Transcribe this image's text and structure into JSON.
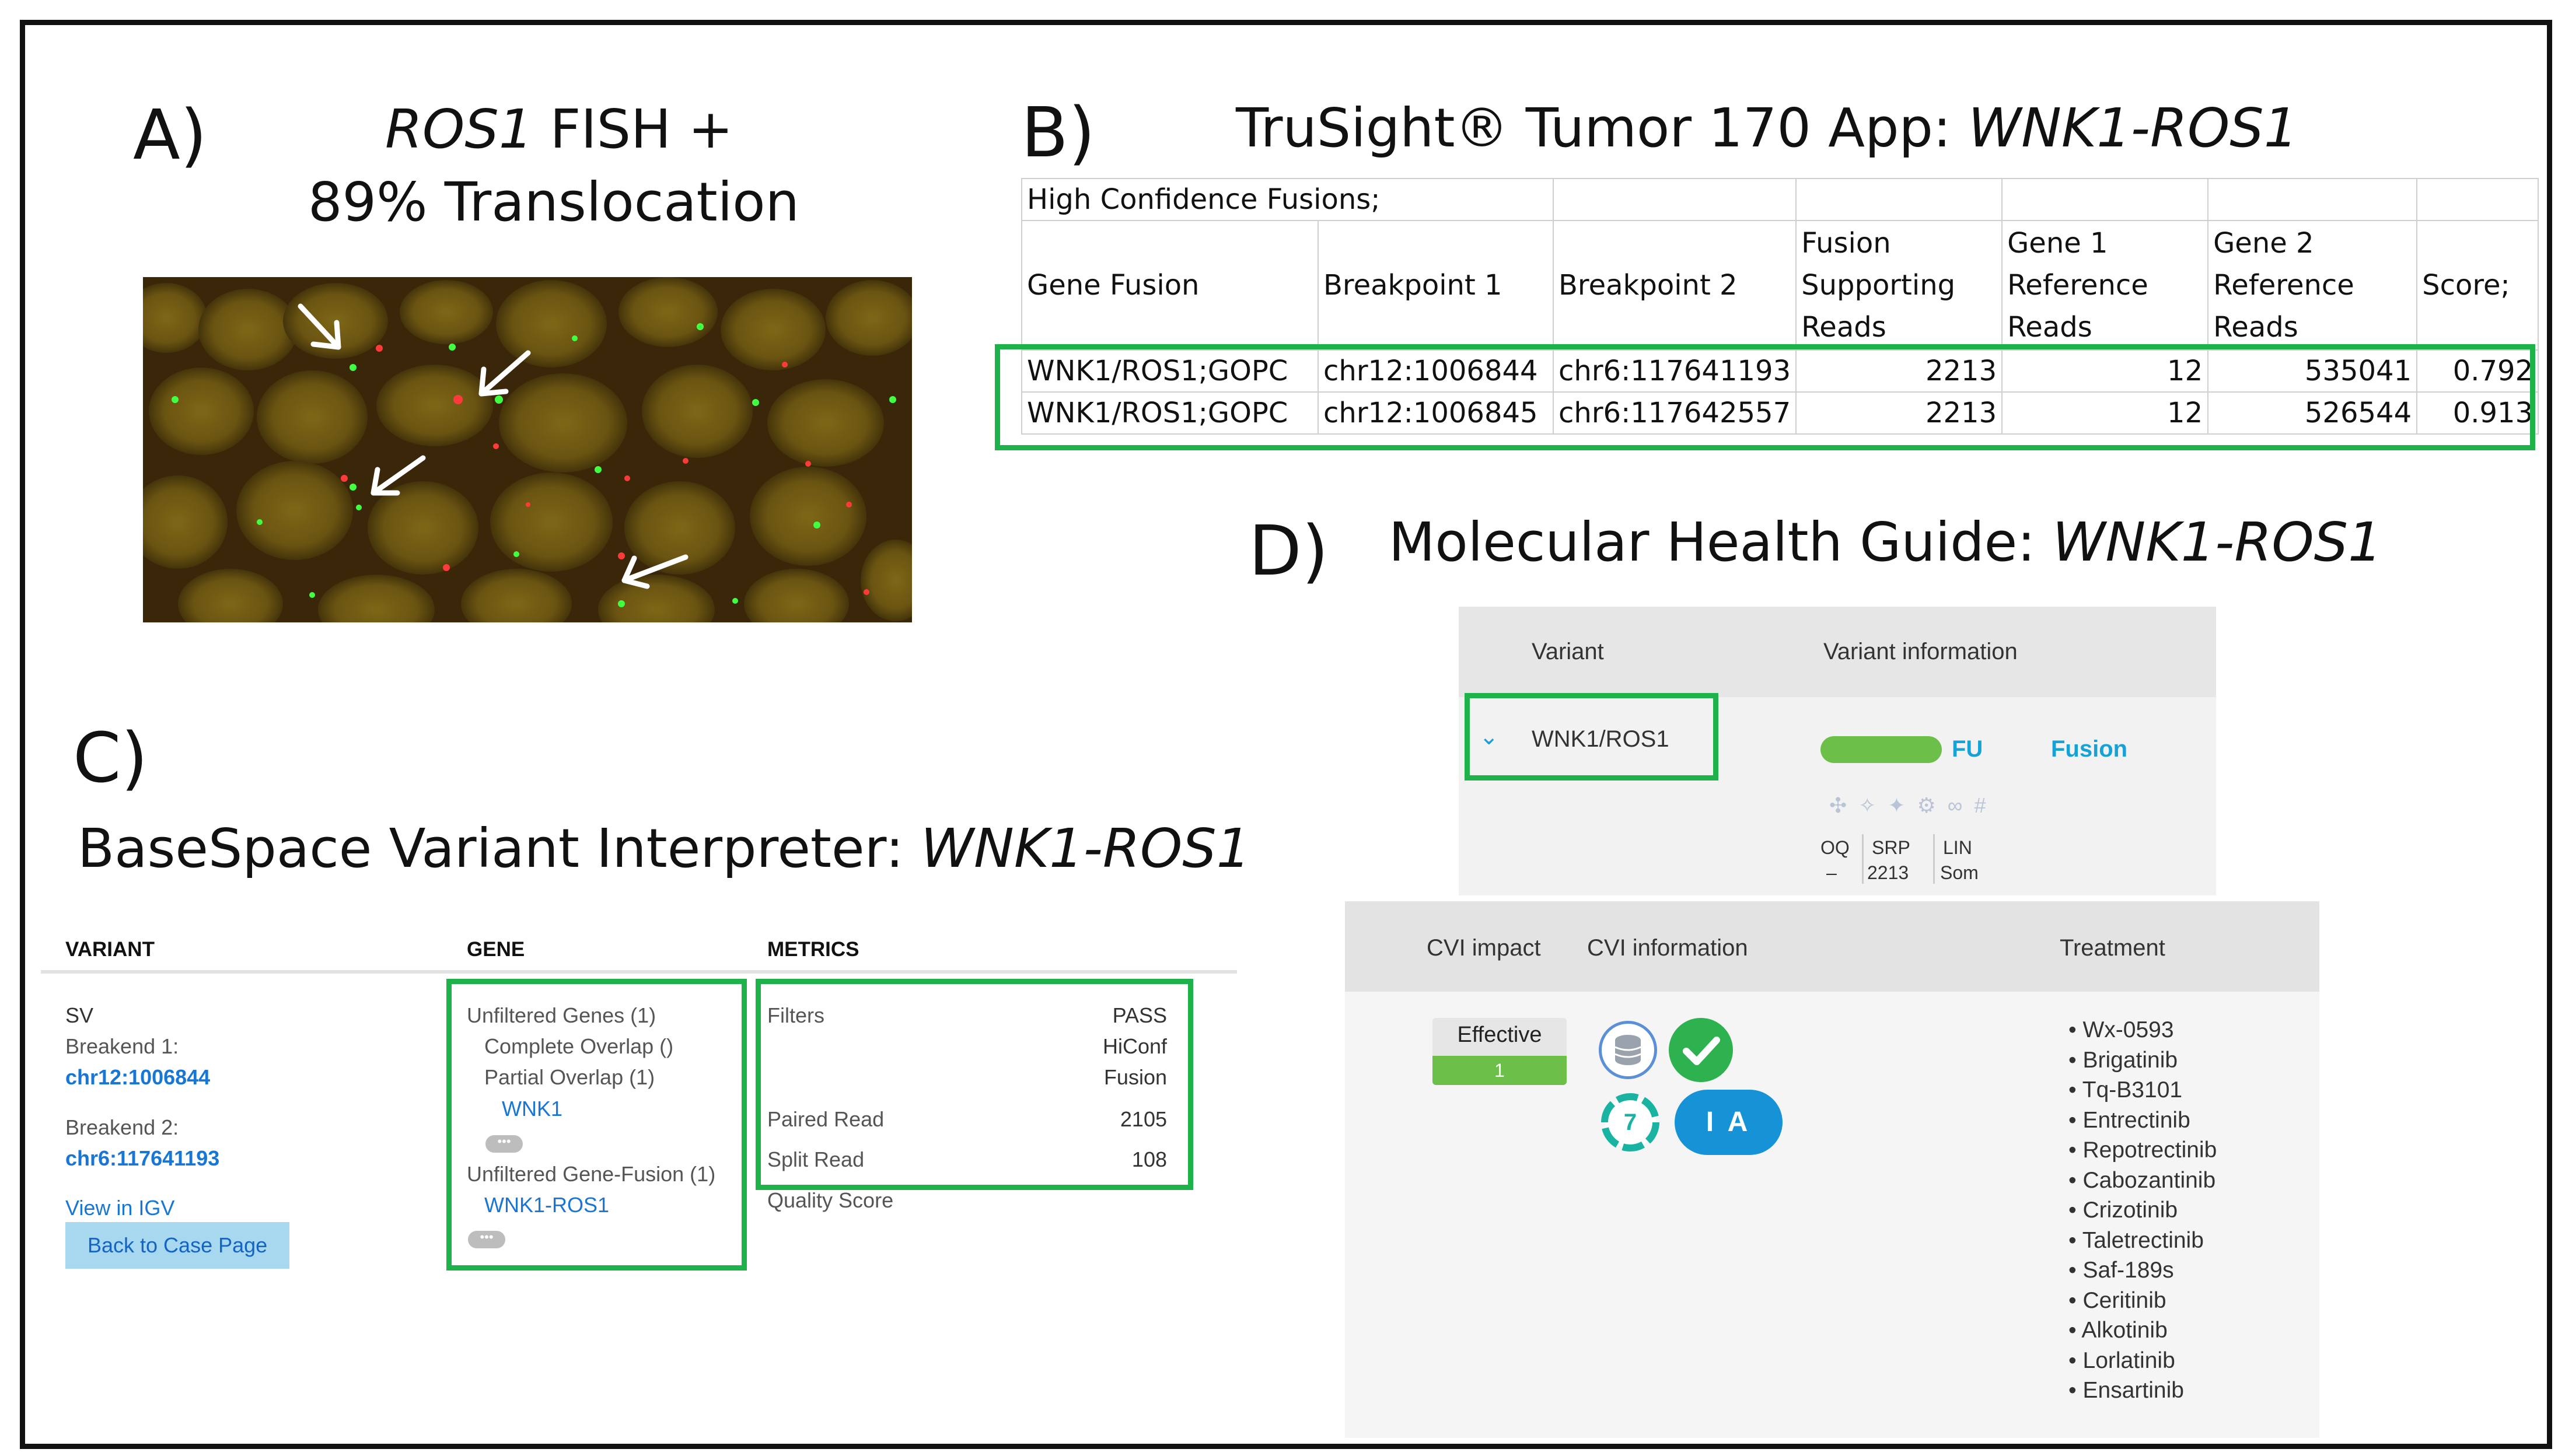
{
  "panel_a": {
    "letter": "A)",
    "title_gene": "ROS1",
    "title_rest": " FISH +",
    "title_line2": "89% Translocation"
  },
  "panel_b": {
    "letter": "B)",
    "title_prefix": "TruSight® Tumor 170 App: ",
    "title_fusion": "WNK1-ROS1",
    "table": {
      "caption": "High Confidence Fusions;",
      "headers": [
        "Gene Fusion",
        "Breakpoint 1",
        "Breakpoint 2",
        "Fusion Supporting Reads",
        "Gene 1 Reference Reads",
        "Gene 2 Reference Reads",
        "Score;"
      ],
      "header_lines": {
        "col3": [
          "Fusion",
          "Supporting",
          "Reads"
        ],
        "col4": [
          "Gene 1",
          "Reference",
          "Reads"
        ],
        "col5": [
          "Gene 2",
          "Reference",
          "Reads"
        ]
      },
      "rows": [
        [
          "WNK1/ROS1;GOPC",
          "chr12:1006844",
          "chr6:117641193",
          "2213",
          "12",
          "535041",
          "0.792"
        ],
        [
          "WNK1/ROS1;GOPC",
          "chr12:1006845",
          "chr6:117642557",
          "2213",
          "12",
          "526544",
          "0.913"
        ]
      ]
    }
  },
  "panel_c": {
    "letter": "C)",
    "title_prefix": "BaseSpace Variant Interpreter: ",
    "title_fusion": "WNK1-ROS1",
    "headers": {
      "variant": "VARIANT",
      "gene": "GENE",
      "metrics": "METRICS"
    },
    "variant": {
      "type": "SV",
      "breakend1_label": "Breakend 1:",
      "breakend1_value": "chr12:1006844",
      "breakend2_label": "Breakend 2:",
      "breakend2_value": "chr6:117641193",
      "view_link": "View in IGV",
      "back_button": "Back to Case Page"
    },
    "gene": {
      "unfiltered_genes": "Unfiltered Genes (1)",
      "complete_overlap": "Complete Overlap ()",
      "partial_overlap": "Partial Overlap (1)",
      "gene_link": "WNK1",
      "unfiltered_fusion": "Unfiltered Gene-Fusion (1)",
      "fusion_link": "WNK1-ROS1",
      "more": "•••"
    },
    "metrics": {
      "filters_label": "Filters",
      "filters_values": [
        "PASS",
        "HiConf",
        "Fusion"
      ],
      "paired_read_label": "Paired Read",
      "paired_read_value": "2105",
      "split_read_label": "Split Read",
      "split_read_value": "108",
      "quality_label": "Quality Score"
    }
  },
  "panel_d": {
    "letter": "D)",
    "title_prefix": "Molecular Health Guide: ",
    "title_fusion": "WNK1-ROS1",
    "top_headers": {
      "variant": "Variant",
      "info": "Variant information"
    },
    "variant_name": "WNK1/ROS1",
    "fu_code": "FU",
    "fu_label": "Fusion",
    "stats_labels": [
      "OQ",
      "SRP",
      "LIN"
    ],
    "stats_values": [
      "–",
      "2213",
      "Som"
    ],
    "bottom_headers": {
      "impact": "CVI impact",
      "info": "CVI information",
      "treatment": "Treatment"
    },
    "impact_label": "Effective",
    "impact_value": "1",
    "evidence_count": "7",
    "evidence_level": "I A",
    "treatments": [
      "Wx-0593",
      "Brigatinib",
      "Tq-B3101",
      "Entrectinib",
      "Repotrectinib",
      "Cabozantinib",
      "Crizotinib",
      "Taletrectinib",
      "Saf-189s",
      "Ceritinib",
      "Alkotinib",
      "Lorlatinib",
      "Ensartinib"
    ]
  },
  "colors": {
    "highlight_green": "#1fb14a",
    "link_blue": "#1976d2",
    "cyan": "#17a2d6",
    "effective_green": "#6cc04a"
  }
}
